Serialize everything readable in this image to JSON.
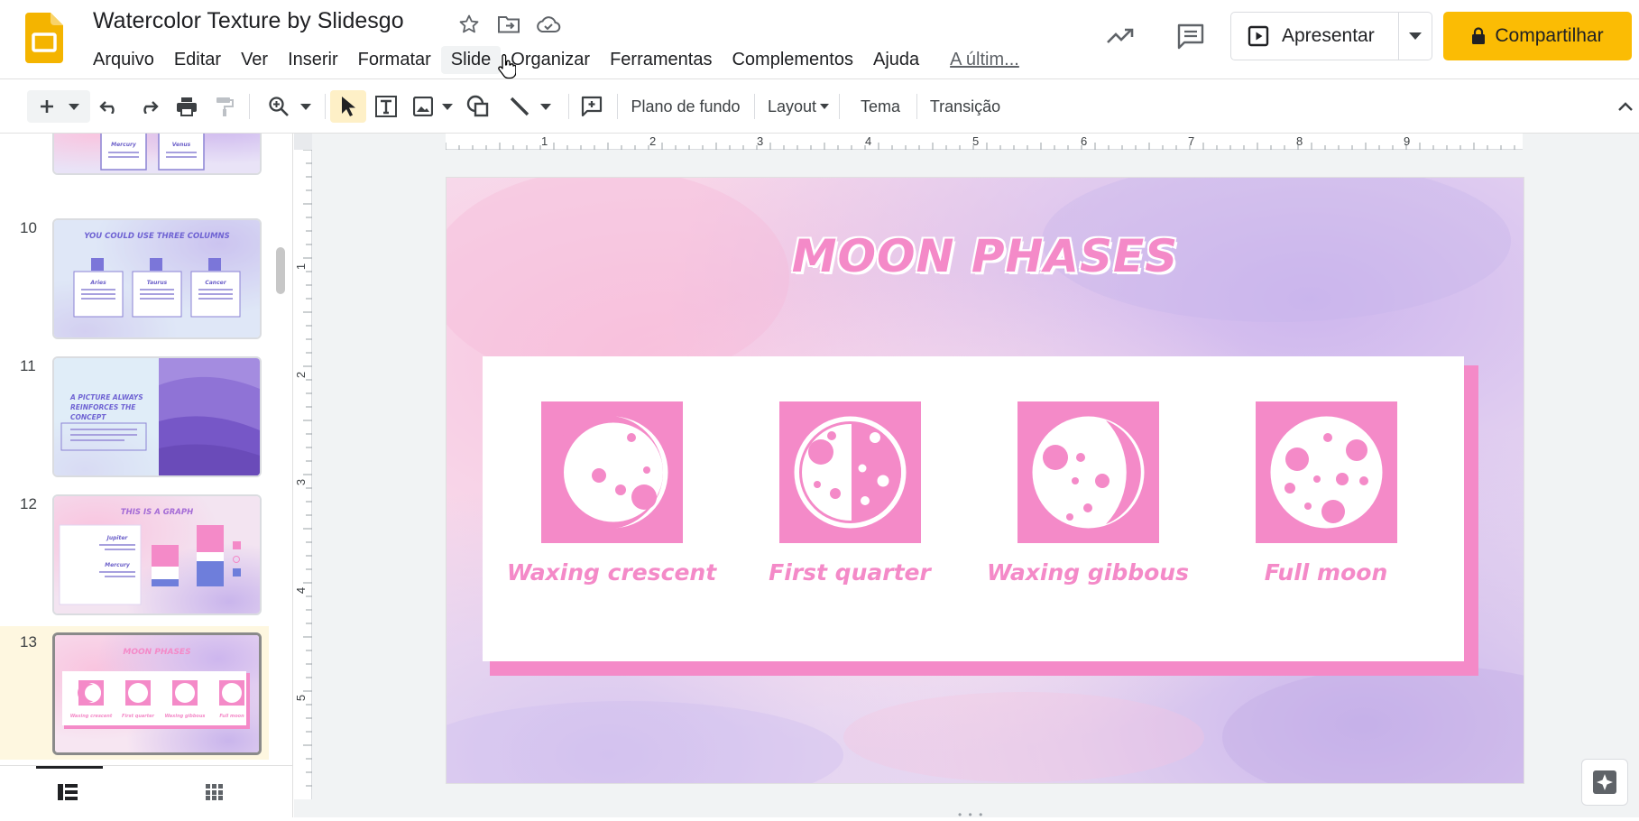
{
  "app": {
    "title": "Watercolor Texture by Slidesgo",
    "brand_color": "#f4b400"
  },
  "menu": {
    "items": [
      "Arquivo",
      "Editar",
      "Ver",
      "Inserir",
      "Formatar",
      "Slide",
      "Organizar",
      "Ferramentas",
      "Complementos",
      "Ajuda"
    ],
    "active_item": "Slide",
    "last_edit": "A últim..."
  },
  "header": {
    "present_label": "Apresentar",
    "share_label": "Compartilhar",
    "share_color": "#fbbc04"
  },
  "toolbar": {
    "background_label": "Plano de fundo",
    "layout_label": "Layout",
    "theme_label": "Tema",
    "transition_label": "Transição"
  },
  "filmstrip": {
    "slides": [
      {
        "number": "10",
        "title": "YOU COULD USE THREE COLUMNS",
        "cols": [
          "Aries",
          "Taurus",
          "Cancer"
        ]
      },
      {
        "number": "11",
        "title": "A PICTURE ALWAYS REINFORCES THE CONCEPT"
      },
      {
        "number": "12",
        "title": "THIS IS A GRAPH",
        "labels": [
          "Jupiter",
          "Mercury"
        ]
      },
      {
        "number": "13",
        "title": "MOON PHASES",
        "labels": [
          "Waxing crescent",
          "First quarter",
          "Waxing gibbous",
          "Full moon"
        ]
      }
    ],
    "partial_slide_labels": [
      "Mercury",
      "Venus"
    ],
    "selected": "13"
  },
  "rulers": {
    "horizontal": [
      "1",
      "2",
      "3",
      "4",
      "5",
      "6",
      "7",
      "8",
      "9"
    ],
    "vertical": [
      "1",
      "2",
      "3",
      "4",
      "5"
    ]
  },
  "slide": {
    "title": "MOON PHASES",
    "accent_color": "#f48ac8",
    "phases": [
      {
        "label": "Waxing crescent",
        "icon": "waxing-crescent-icon"
      },
      {
        "label": "First quarter",
        "icon": "first-quarter-icon"
      },
      {
        "label": "Waxing gibbous",
        "icon": "waxing-gibbous-icon"
      },
      {
        "label": "Full moon",
        "icon": "full-moon-icon"
      }
    ]
  }
}
